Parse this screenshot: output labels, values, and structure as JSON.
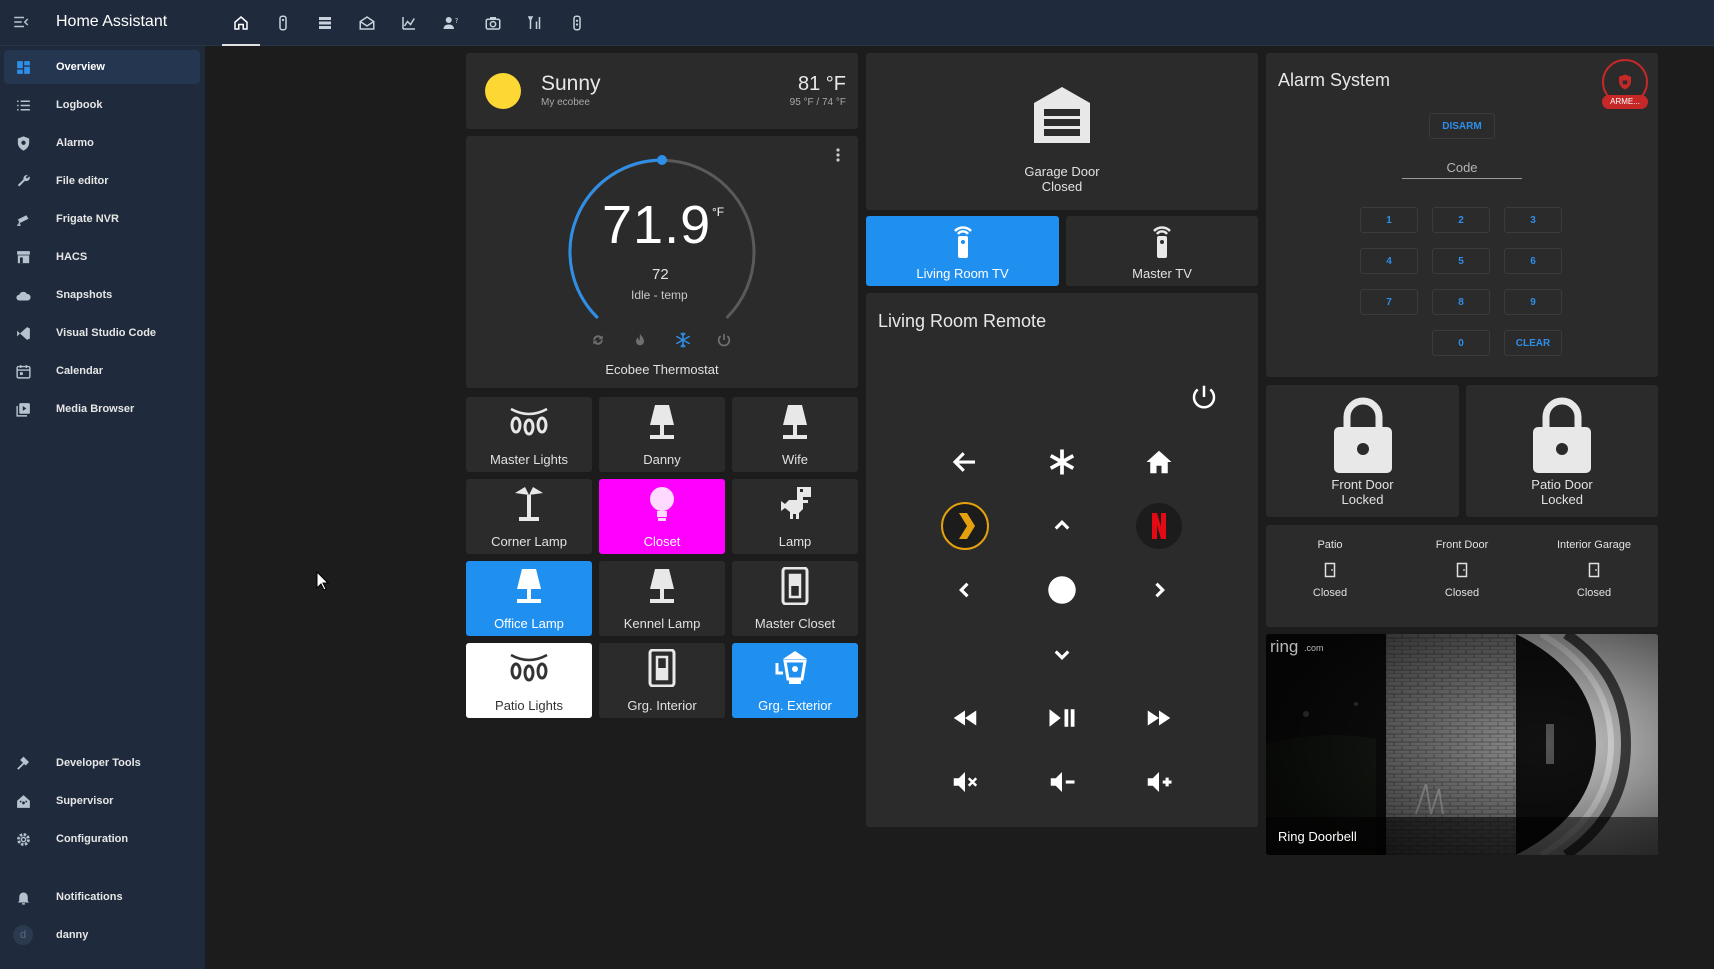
{
  "app": {
    "title": "Home Assistant"
  },
  "views": [
    {
      "icon": "home-icon",
      "active": true
    },
    {
      "icon": "remote-icon"
    },
    {
      "icon": "server-icon"
    },
    {
      "icon": "email-open-icon"
    },
    {
      "icon": "chart-icon"
    },
    {
      "icon": "account-question-icon"
    },
    {
      "icon": "camera-icon"
    },
    {
      "icon": "tools-icon"
    },
    {
      "icon": "remote-alt-icon"
    }
  ],
  "sidebar": {
    "items": [
      {
        "label": "Overview",
        "icon": "dashboard-icon",
        "selected": true
      },
      {
        "label": "Logbook",
        "icon": "logbook-icon"
      },
      {
        "label": "Alarmo",
        "icon": "shield-icon"
      },
      {
        "label": "File editor",
        "icon": "wrench-icon"
      },
      {
        "label": "Frigate NVR",
        "icon": "cctv-icon"
      },
      {
        "label": "HACS",
        "icon": "hacs-icon"
      },
      {
        "label": "Snapshots",
        "icon": "cloud-icon"
      },
      {
        "label": "Visual Studio Code",
        "icon": "vscode-icon"
      },
      {
        "label": "Calendar",
        "icon": "calendar-icon"
      },
      {
        "label": "Media Browser",
        "icon": "play-box-icon"
      }
    ],
    "bottom": [
      {
        "label": "Developer Tools",
        "icon": "hammer-icon"
      },
      {
        "label": "Supervisor",
        "icon": "home-assistant-icon"
      },
      {
        "label": "Configuration",
        "icon": "gear-icon"
      },
      {
        "label": "Notifications",
        "icon": "bell-icon"
      },
      {
        "label": "danny",
        "avatar": "d"
      }
    ]
  },
  "weather": {
    "condition": "Sunny",
    "source": "My ecobee",
    "temp": "81 °F",
    "range": "95 °F / 74 °F"
  },
  "thermostat": {
    "current": "71.9",
    "unit": "°F",
    "target": "72",
    "status": "Idle - temp",
    "name": "Ecobee Thermostat",
    "setpoint_fraction": 0.5
  },
  "lights": [
    {
      "label": "Master Lights",
      "icon": "string-lights-icon",
      "state": "off"
    },
    {
      "label": "Danny",
      "icon": "lamp-icon",
      "state": "off"
    },
    {
      "label": "Wife",
      "icon": "lamp-icon",
      "state": "off"
    },
    {
      "label": "Corner Lamp",
      "icon": "floor-lamp-icon",
      "state": "off"
    },
    {
      "label": "Closet",
      "icon": "lightbulb-icon",
      "state": "magenta"
    },
    {
      "label": "Lamp",
      "icon": "dinosaur-icon",
      "state": "off"
    },
    {
      "label": "Office Lamp",
      "icon": "lamp-icon",
      "state": "blue"
    },
    {
      "label": "Kennel Lamp",
      "icon": "lamp-icon",
      "state": "off"
    },
    {
      "label": "Master Closet",
      "icon": "light-switch-icon",
      "state": "off"
    },
    {
      "label": "Patio Lights",
      "icon": "string-lights-icon",
      "state": "white"
    },
    {
      "label": "Grg. Interior",
      "icon": "light-switch-icon",
      "state": "off"
    },
    {
      "label": "Grg. Exterior",
      "icon": "outdoor-lamp-icon",
      "state": "blue"
    }
  ],
  "garage": {
    "name": "Garage Door",
    "state": "Closed"
  },
  "tv": [
    {
      "label": "Living Room TV",
      "active": true
    },
    {
      "label": "Master TV",
      "active": false
    }
  ],
  "remote": {
    "title": "Living Room Remote"
  },
  "alarm": {
    "title": "Alarm System",
    "badge": "ARME...",
    "disarm": "DISARM",
    "code_label": "Code",
    "keys": [
      "1",
      "2",
      "3",
      "4",
      "5",
      "6",
      "7",
      "8",
      "9",
      "0",
      "CLEAR"
    ]
  },
  "locks": [
    {
      "name": "Front Door",
      "state": "Locked"
    },
    {
      "name": "Patio Door",
      "state": "Locked"
    }
  ],
  "sensors": [
    {
      "name": "Patio",
      "state": "Closed"
    },
    {
      "name": "Front Door",
      "state": "Closed"
    },
    {
      "name": "Interior Garage",
      "state": "Closed"
    }
  ],
  "camera": {
    "brand": "ring",
    "brand_suffix": ".com",
    "name": "Ring Doorbell"
  },
  "colors": {
    "accent": "#1f8ff0",
    "magenta": "#ff00ff",
    "alarm_red": "#c62828",
    "sun": "#fdd835"
  }
}
